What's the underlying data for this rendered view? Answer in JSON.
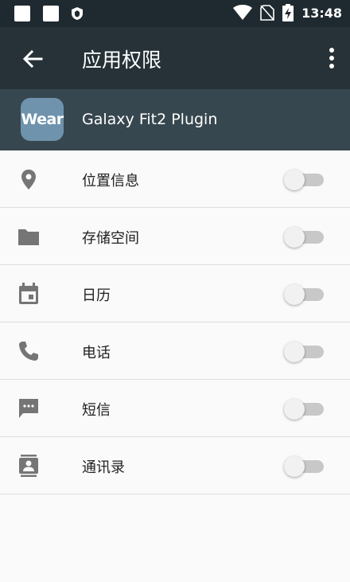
{
  "status_bar": {
    "time": "13:48",
    "icons": [
      "notification-square-icon",
      "notification-square-icon",
      "shield-icon",
      "wifi-icon",
      "no-sim-icon",
      "battery-charging-icon"
    ]
  },
  "toolbar": {
    "back_icon": "arrow-back-icon",
    "title": "应用权限",
    "more_icon": "more-vert-icon"
  },
  "app": {
    "icon_text": "Wear",
    "name": "Galaxy Fit2 Plugin",
    "icon_color": "#6f93ad"
  },
  "permissions": [
    {
      "icon": "location-pin-icon",
      "label": "位置信息",
      "enabled": false
    },
    {
      "icon": "folder-icon",
      "label": "存储空间",
      "enabled": false
    },
    {
      "icon": "calendar-icon",
      "label": "日历",
      "enabled": false
    },
    {
      "icon": "phone-icon",
      "label": "电话",
      "enabled": false
    },
    {
      "icon": "sms-icon",
      "label": "短信",
      "enabled": false
    },
    {
      "icon": "contacts-icon",
      "label": "通讯录",
      "enabled": false
    }
  ],
  "colors": {
    "toolbar": "#263238",
    "app_bar": "#37474f",
    "background": "#fafafa",
    "icon_gray": "#757575"
  }
}
